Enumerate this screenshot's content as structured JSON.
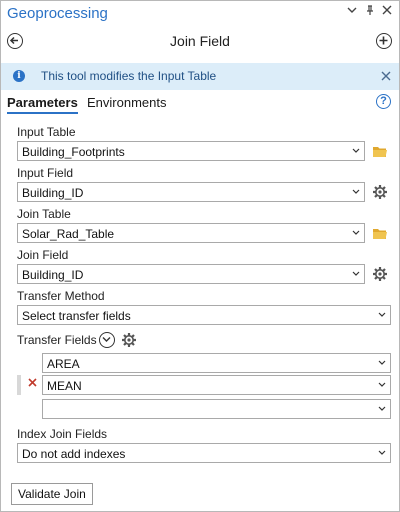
{
  "window": {
    "title": "Geoprocessing",
    "controls": [
      "chevron-down-icon",
      "pin-icon",
      "close-icon"
    ]
  },
  "header": {
    "title": "Join Field",
    "back_icon": "back-arrow-icon",
    "add_icon": "add-icon"
  },
  "info": {
    "text": "This tool modifies the Input Table",
    "icon": "info-icon",
    "close_icon": "close-icon"
  },
  "tabs": [
    {
      "label": "Parameters",
      "active": true
    },
    {
      "label": "Environments",
      "active": false
    }
  ],
  "help_icon": "help-icon",
  "params": {
    "input_table": {
      "label": "Input Table",
      "value": "Building_Footprints",
      "side_icon": "folder-icon"
    },
    "input_field": {
      "label": "Input Field",
      "value": "Building_ID",
      "side_icon": "gear-icon"
    },
    "join_table": {
      "label": "Join Table",
      "value": "Solar_Rad_Table",
      "side_icon": "folder-icon"
    },
    "join_field": {
      "label": "Join Field",
      "value": "Building_ID",
      "side_icon": "gear-icon"
    },
    "transfer_method": {
      "label": "Transfer Method",
      "value": "Select transfer fields"
    },
    "transfer_fields": {
      "label": "Transfer Fields",
      "rows": [
        {
          "value": "AREA"
        },
        {
          "value": "MEAN"
        },
        {
          "value": ""
        }
      ]
    },
    "index_join_fields": {
      "label": "Index Join Fields",
      "value": "Do not add indexes"
    }
  },
  "buttons": {
    "validate": "Validate Join"
  },
  "colors": {
    "accent": "#2b72c6",
    "info_bg": "#dcedf9",
    "folder": "#e0a82e",
    "remove_x": "#c0392b"
  }
}
